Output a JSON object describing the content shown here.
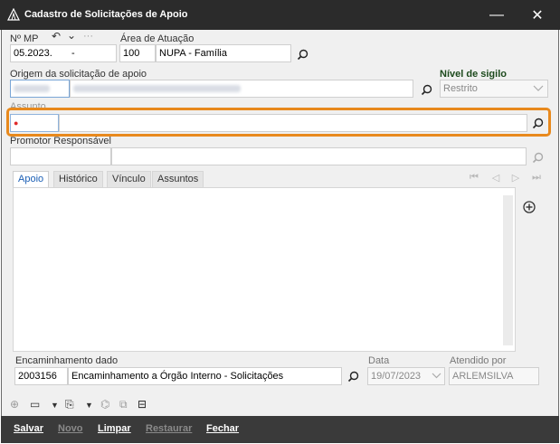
{
  "window": {
    "title": "Cadastro de Solicitações de Apoio",
    "minimize_glyph": "—",
    "close_glyph": "✕"
  },
  "form": {
    "mp": {
      "label": "Nº MP",
      "value_left": "05.2023.",
      "value_right": "-"
    },
    "area": {
      "label": "Área de Atuação",
      "code": "100",
      "name": "NUPA - Família"
    },
    "origem": {
      "label": "Origem da solicitação de apoio"
    },
    "sigilo": {
      "label": "Nível de sigilo",
      "value": "Restrito"
    },
    "assunto": {
      "label": "Assunto",
      "required_marker": "●"
    },
    "promotor": {
      "label": "Promotor Responsável"
    }
  },
  "tabs": [
    "Apoio",
    "Histórico",
    "Vínculo",
    "Assuntos"
  ],
  "encaminhamento": {
    "label": "Encaminhamento dado",
    "code": "2003156",
    "name": "Encaminhamento a Órgão Interno - Solicitações"
  },
  "data_field": {
    "label": "Data",
    "value": "19/07/2023"
  },
  "atendido": {
    "label": "Atendido por",
    "value": "ARLEMSILVA"
  },
  "buttons": {
    "salvar": "Salvar",
    "novo": "Novo",
    "limpar": "Limpar",
    "restaurar": "Restaurar",
    "fechar": "Fechar"
  },
  "colors": {
    "highlight": "#e8891d",
    "active_tab": "#1b5fb5",
    "required_dot": "#e02a2a"
  }
}
